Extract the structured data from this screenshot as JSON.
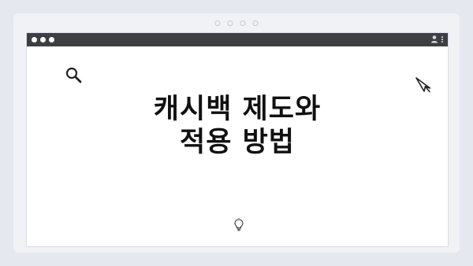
{
  "headline": {
    "line1": "캐시백 제도와",
    "line2": "적용 방법"
  },
  "icons": {
    "search": "search-icon",
    "cursor": "cursor-icon",
    "bulb": "lightbulb-icon",
    "user": "user-icon",
    "menu": "more-vertical-icon"
  },
  "colors": {
    "background": "#e5e8ee",
    "titlebar": "#3c3e42",
    "window": "#ffffff",
    "text": "#111111"
  }
}
